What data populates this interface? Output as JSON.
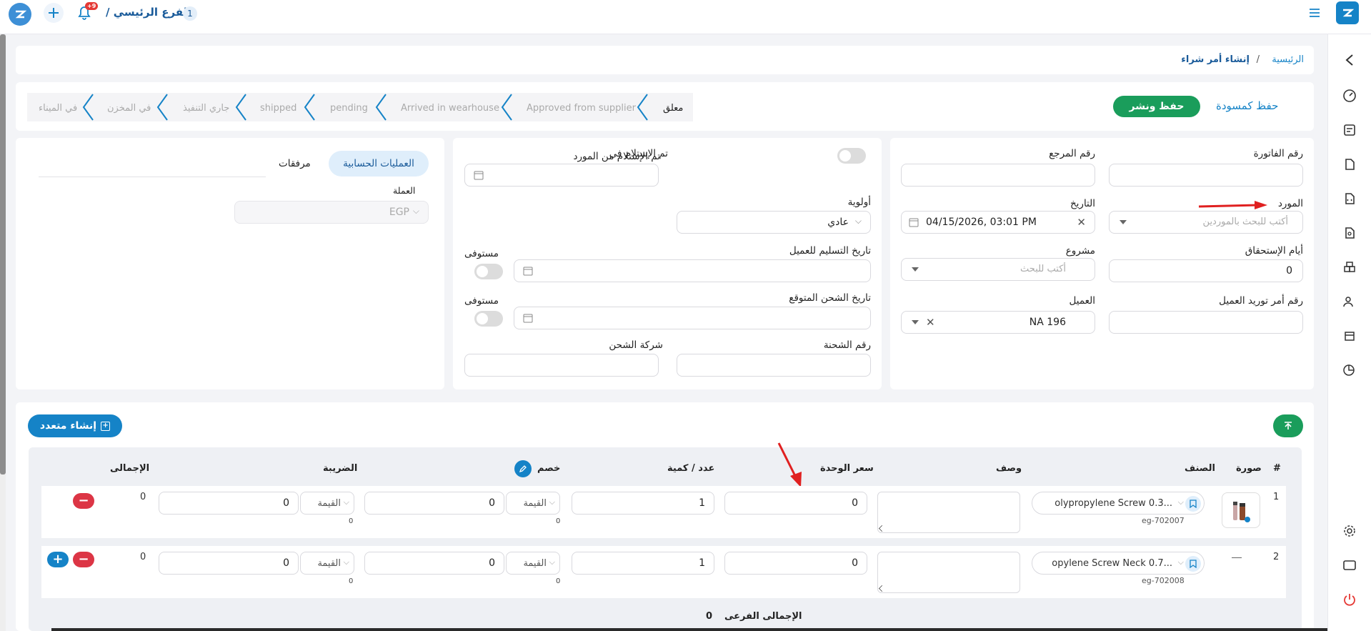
{
  "topbar": {
    "branch_title": "الفرع الرئيسي /",
    "branch_badge": "1",
    "notif_badge": "+9"
  },
  "breadcrumb": {
    "home": "الرئيسية",
    "sep": "/",
    "current": "إنشاء أمر شراء"
  },
  "actions": {
    "save_publish": "حفظ ونشر",
    "save_draft": "حفظ كمسودة"
  },
  "status_steps": [
    "معلق",
    "Approved from supplier",
    "Arrived in wearhouse",
    "pending",
    "shipped",
    "جاري التنفيذ",
    "في المخزن",
    "في الميناء"
  ],
  "form": {
    "invoice_no_label": "رقم الفاتورة",
    "ref_no_label": "رقم المرجع",
    "supplier_label": "المورد",
    "supplier_placeholder": "أكتب للبحث بالموردين",
    "date_label": "التاريخ",
    "date_value": "04/15/2026, 03:01 PM",
    "due_days_label": "أيام الإستحقاق",
    "due_days_value": "0",
    "project_label": "مشروع",
    "project_placeholder": "أكتب للبحث",
    "client_po_label": "رقم أمر توريد العميل",
    "client_label": "العميل",
    "client_value": "NA 196"
  },
  "shipping": {
    "received_toggle_label": "تم الإستلام من المورد",
    "received_on_label": "تم الإستلام فى",
    "priority_label": "أولوية",
    "priority_value": "عادي",
    "delivery_date_label": "تاريخ التسليم للعميل",
    "fulfilled_label_1": "مستوفى",
    "expected_ship_label": "تاريخ الشحن المتوقع",
    "fulfilled_label_2": "مستوفى",
    "shipment_no_label": "رقم الشحنة",
    "shipping_company_label": "شركة الشحن"
  },
  "side_panel": {
    "tab_accounting": "العمليات الحسابية",
    "tab_attachments": "مرفقات",
    "currency_label": "العملة",
    "currency_value": "EGP"
  },
  "items": {
    "bulk_create_label": "إنشاء متعدد",
    "columns": {
      "num": "#",
      "image": "صورة",
      "item": "الصنف",
      "description": "وصف",
      "unit_price": "سعر الوحدة",
      "qty": "عدد / كمية",
      "discount": "خصم",
      "tax": "الضريبة",
      "total": "الإجمالى"
    },
    "rows": [
      {
        "num": "1",
        "item": "olypropylene Screw 0.3...",
        "sku": "eg-702007",
        "unit_price": "0",
        "qty": "1",
        "discount_type": "القيمة",
        "discount": "0",
        "discount_sub": "0",
        "tax_type": "القيمة",
        "tax": "0",
        "tax_sub": "0",
        "total": "0"
      },
      {
        "num": "2",
        "item": "opylene Screw Neck 0.7...",
        "sku": "eg-702008",
        "unit_price": "0",
        "qty": "1",
        "discount_type": "القيمة",
        "discount": "0",
        "discount_sub": "0",
        "tax_type": "القيمة",
        "tax": "0",
        "tax_sub": "0",
        "total": "0"
      }
    ],
    "subtotal_label": "الإجمالى الفرعى",
    "subtotal_value": "0"
  },
  "colors": {
    "brand": "#1583c7",
    "green": "#1a9d5b",
    "red": "#dc3545",
    "arrow": "#e02020"
  }
}
